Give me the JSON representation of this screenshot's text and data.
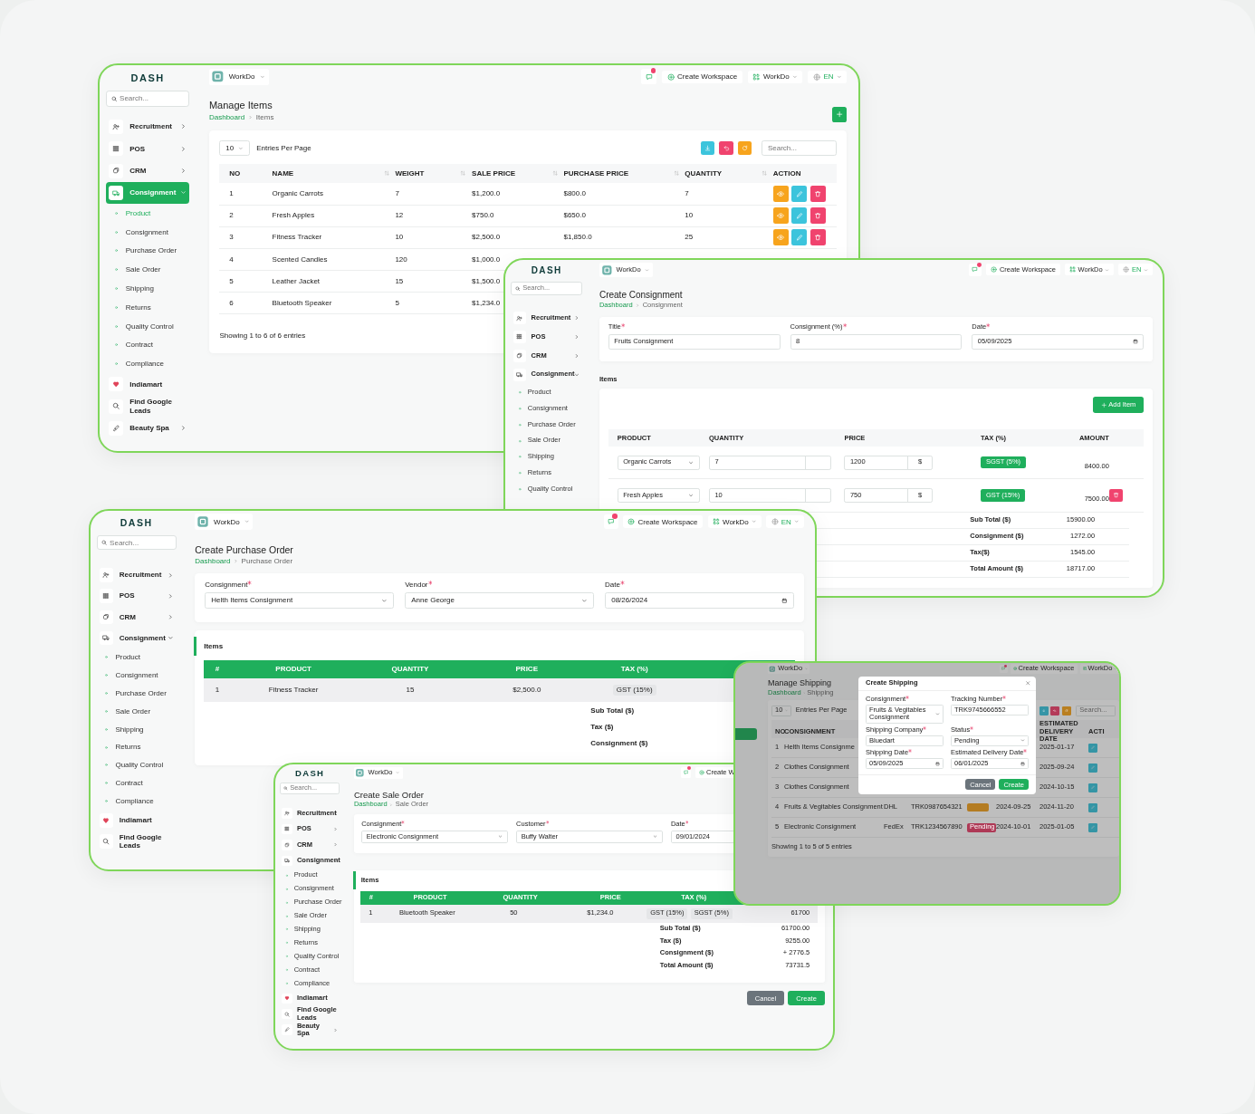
{
  "windows": [
    {
      "kind": "items_list",
      "logo": "DASH",
      "sidebar": {
        "search": "Search...",
        "items": [
          {
            "label": "Recruitment",
            "kind": "group",
            "selected": false,
            "expanded": false
          },
          {
            "label": "POS",
            "kind": "group",
            "selected": false,
            "expanded": false
          },
          {
            "label": "CRM",
            "kind": "group",
            "selected": false,
            "expanded": false
          },
          {
            "label": "Consignment",
            "kind": "group",
            "selected": true,
            "expanded": true,
            "children": [
              {
                "label": "Product",
                "selected": true
              },
              {
                "label": "Consignment",
                "selected": false
              },
              {
                "label": "Purchase Order",
                "selected": false
              },
              {
                "label": "Sale Order",
                "selected": false
              },
              {
                "label": "Shipping",
                "selected": false
              },
              {
                "label": "Returns",
                "selected": false
              },
              {
                "label": "Quality Control",
                "selected": false
              },
              {
                "label": "Contract",
                "selected": false
              },
              {
                "label": "Compliance",
                "selected": false
              }
            ]
          },
          {
            "label": "Indiamart",
            "kind": "link",
            "selected": false
          },
          {
            "label": "Find Google Leads",
            "kind": "link",
            "selected": false
          },
          {
            "label": "Beauty Spa",
            "kind": "group",
            "selected": false,
            "expanded": false
          }
        ]
      },
      "topbar": {
        "workspace": "WorkDo",
        "notification": true,
        "actions": [
          {
            "kind": "create",
            "label": "Create Workspace"
          },
          {
            "kind": "switch",
            "label": "WorkDo"
          },
          {
            "kind": "lang",
            "label": "EN"
          }
        ]
      },
      "title": "Manage Items",
      "breadcrumb": [
        "Dashboard",
        "Items"
      ],
      "add_button": true,
      "table": {
        "entries": "10",
        "entries_label": "Entries Per Page",
        "search": "Search...",
        "tools": [
          {
            "kind": "download",
            "color": "#3cc4dc"
          },
          {
            "kind": "undo",
            "color": "#f0436e"
          },
          {
            "kind": "refresh",
            "color": "#f7a41d"
          }
        ],
        "columns": [
          "NO",
          "NAME",
          "WEIGHT",
          "SALE PRICE",
          "PURCHASE PRICE",
          "QUANTITY",
          "ACTION"
        ],
        "rows": [
          {
            "cells": [
              "1",
              "Organic Carrots",
              "7",
              "$1,200.0",
              "$800.0",
              "7"
            ],
            "actions": true
          },
          {
            "cells": [
              "2",
              "Fresh Apples",
              "12",
              "$750.0",
              "$650.0",
              "10"
            ],
            "actions": true
          },
          {
            "cells": [
              "3",
              "Fitness Tracker",
              "10",
              "$2,500.0",
              "$1,850.0",
              "25"
            ],
            "actions": true
          },
          {
            "cells": [
              "4",
              "Scented Candles",
              "120",
              "$1,000.0"
            ]
          },
          {
            "cells": [
              "5",
              "Leather Jacket",
              "15",
              "$1,500.0"
            ]
          },
          {
            "cells": [
              "6",
              "Bluetooth Speaker",
              "5",
              "$1,234.0"
            ]
          }
        ],
        "footer": "Showing 1 to 6 of 6 entries"
      }
    },
    {
      "kind": "consignment_form",
      "logo": "DASH",
      "sidebar": {
        "search": "Search...",
        "items": [
          {
            "label": "Recruitment",
            "kind": "group",
            "selected": false,
            "expanded": false
          },
          {
            "label": "POS",
            "kind": "group",
            "selected": false,
            "expanded": false
          },
          {
            "label": "CRM",
            "kind": "group",
            "selected": false,
            "expanded": false
          },
          {
            "label": "Consignment",
            "kind": "group",
            "selected": false,
            "expanded": true,
            "children": [
              {
                "label": "Product",
                "selected": false
              },
              {
                "label": "Consignment",
                "selected": false
              },
              {
                "label": "Purchase Order",
                "selected": false
              },
              {
                "label": "Sale Order",
                "selected": false
              },
              {
                "label": "Shipping",
                "selected": false
              },
              {
                "label": "Returns",
                "selected": false
              },
              {
                "label": "Quality Control",
                "selected": false
              }
            ]
          }
        ]
      },
      "topbar": {
        "workspace": "WorkDo",
        "notification": true,
        "actions": [
          {
            "kind": "create",
            "label": "Create Workspace"
          },
          {
            "kind": "switch",
            "label": "WorkDo"
          },
          {
            "kind": "lang",
            "label": "EN"
          }
        ]
      },
      "title": "Create Consignment",
      "breadcrumb": [
        "Dashboard",
        "Consignment"
      ],
      "fields": [
        {
          "label": "Title",
          "required": true,
          "kind": "text",
          "value": "Fruits Consignment"
        },
        {
          "label": "Consignment (%)",
          "required": true,
          "kind": "text",
          "value": "8"
        },
        {
          "label": "Date",
          "required": true,
          "kind": "date",
          "value": "05/09/2025"
        }
      ],
      "items_title": "Items",
      "editor": {
        "add_label": "Add Item",
        "columns": [
          "PRODUCT",
          "QUANTITY",
          "PRICE",
          "TAX (%)",
          "AMOUNT"
        ],
        "rows": [
          {
            "product": "Organic Carrots",
            "quantity": "7",
            "price": "1200",
            "currency": "$",
            "taxes": [
              "SGST (5%)"
            ],
            "amount": "8400.00",
            "deletable": false
          },
          {
            "product": "Fresh Apples",
            "quantity": "10",
            "price": "750",
            "currency": "$",
            "taxes": [
              "GST (15%)"
            ],
            "amount": "7500.00",
            "deletable": true
          }
        ],
        "totals": [
          {
            "label": "Sub Total ($)",
            "value": "15900.00"
          },
          {
            "label": "Consignment ($)",
            "value": "1272.00"
          },
          {
            "label": "Tax($)",
            "value": "1545.00"
          },
          {
            "label": "Total Amount ($)",
            "value": "18717.00"
          }
        ]
      }
    },
    {
      "kind": "order_form",
      "logo": "DASH",
      "sidebar": {
        "search": "Search...",
        "items": [
          {
            "label": "Recruitment",
            "kind": "group",
            "selected": false,
            "expanded": false
          },
          {
            "label": "POS",
            "kind": "group",
            "selected": false,
            "expanded": false
          },
          {
            "label": "CRM",
            "kind": "group",
            "selected": false,
            "expanded": false
          },
          {
            "label": "Consignment",
            "kind": "group",
            "selected": false,
            "expanded": true,
            "children": [
              {
                "label": "Product",
                "selected": false
              },
              {
                "label": "Consignment",
                "selected": false
              },
              {
                "label": "Purchase Order",
                "selected": false
              },
              {
                "label": "Sale Order",
                "selected": false
              },
              {
                "label": "Shipping",
                "selected": false
              },
              {
                "label": "Returns",
                "selected": false
              },
              {
                "label": "Quality Control",
                "selected": false
              },
              {
                "label": "Contract",
                "selected": false
              },
              {
                "label": "Compliance",
                "selected": false
              }
            ]
          },
          {
            "label": "Indiamart",
            "kind": "link",
            "selected": false
          },
          {
            "label": "Find Google Leads",
            "kind": "link",
            "selected": false
          }
        ]
      },
      "topbar": {
        "workspace": "WorkDo",
        "notification": true,
        "actions": [
          {
            "kind": "create",
            "label": "Create Workspace"
          },
          {
            "kind": "switch",
            "label": "WorkDo"
          },
          {
            "kind": "lang",
            "label": "EN"
          }
        ]
      },
      "title": "Create Purchase Order",
      "breadcrumb": [
        "Dashboard",
        "Purchase Order"
      ],
      "fields": [
        {
          "label": "Consignment",
          "required": true,
          "kind": "select",
          "value": "Helth Items Consignment"
        },
        {
          "label": "Vendor",
          "required": true,
          "kind": "select",
          "value": "Anne George"
        },
        {
          "label": "Date",
          "required": true,
          "kind": "date",
          "value": "08/26/2024"
        }
      ],
      "order": {
        "title": "Items",
        "columns": [
          "#",
          "PRODUCT",
          "QUANTITY",
          "PRICE",
          "TAX (%)"
        ],
        "rows": [
          {
            "cells": [
              "1",
              "Fitness Tracker",
              "15",
              "$2,500.0"
            ],
            "taxes": [
              "GST (15%)"
            ]
          }
        ],
        "totals": [
          {
            "label": "Sub Total ($)"
          },
          {
            "label": "Tax ($)"
          },
          {
            "label": "Consignment ($)"
          }
        ]
      }
    },
    {
      "kind": "order_form",
      "logo": "DASH",
      "sidebar": {
        "search": "Search...",
        "items": [
          {
            "label": "Recruitment",
            "kind": "group",
            "selected": false,
            "expanded": false
          },
          {
            "label": "POS",
            "kind": "group",
            "selected": false,
            "expanded": false
          },
          {
            "label": "CRM",
            "kind": "group",
            "selected": false,
            "expanded": false
          },
          {
            "label": "Consignment",
            "kind": "group",
            "selected": false,
            "expanded": true,
            "children": [
              {
                "label": "Product",
                "selected": false
              },
              {
                "label": "Consignment",
                "selected": false
              },
              {
                "label": "Purchase Order",
                "selected": false
              },
              {
                "label": "Sale Order",
                "selected": false
              },
              {
                "label": "Shipping",
                "selected": false
              },
              {
                "label": "Returns",
                "selected": false
              },
              {
                "label": "Quality Control",
                "selected": false
              },
              {
                "label": "Contract",
                "selected": false
              },
              {
                "label": "Compliance",
                "selected": false
              }
            ]
          },
          {
            "label": "Indiamart",
            "kind": "link",
            "selected": false
          },
          {
            "label": "Find Google Leads",
            "kind": "link",
            "selected": false
          },
          {
            "label": "Beauty Spa",
            "kind": "group",
            "selected": false,
            "expanded": false
          }
        ]
      },
      "topbar": {
        "workspace": "WorkDo",
        "notification": true,
        "actions": [
          {
            "kind": "create",
            "label": "Create W"
          }
        ]
      },
      "title": "Create Sale Order",
      "breadcrumb": [
        "Dashboard",
        "Sale Order"
      ],
      "fields": [
        {
          "label": "Consignment",
          "required": true,
          "kind": "select",
          "value": "Electronic Consignment"
        },
        {
          "label": "Customer",
          "required": true,
          "kind": "select",
          "value": "Buffy Walter"
        },
        {
          "label": "Date",
          "required": true,
          "kind": "text",
          "value": "09/01/2024"
        }
      ],
      "order": {
        "title": "Items",
        "columns": [
          "#",
          "PRODUCT",
          "QUANTITY",
          "PRICE",
          "TAX (%)"
        ],
        "rows": [
          {
            "cells": [
              "1",
              "Bluetooth Speaker",
              "50",
              "$1,234.0"
            ],
            "taxes": [
              "GST (15%)",
              "SGST (5%)"
            ],
            "amount": "61700"
          }
        ],
        "totals": [
          {
            "label": "Sub Total ($)",
            "value": "61700.00"
          },
          {
            "label": "Tax ($)",
            "value": "9255.00"
          },
          {
            "label": "Consignment ($)",
            "value": "+ 2776.5"
          },
          {
            "label": "Total Amount ($)",
            "value": "73731.5"
          }
        ]
      },
      "buttons": [
        {
          "kind": "cancel",
          "label": "Cancel"
        },
        {
          "kind": "create",
          "label": "Create"
        }
      ]
    },
    {
      "kind": "shipping",
      "topbar": {
        "workspace": "WorkDo",
        "notification": true,
        "actions": [
          {
            "kind": "create",
            "label": "Create Workspace"
          },
          {
            "kind": "switch",
            "label": "WorkDo"
          }
        ]
      },
      "title": "Manage Shipping",
      "breadcrumb": [
        "Dashboard",
        "Shipping"
      ],
      "table": {
        "entries": "10",
        "entries_label": "Entries Per Page",
        "search": "Search...",
        "tools": [
          {
            "kind": "download",
            "color": "#3695a6"
          },
          {
            "kind": "undo",
            "color": "#b43b59"
          },
          {
            "kind": "refresh",
            "color": "#b97f20"
          }
        ],
        "columns": [
          {
            "label": "NO"
          },
          {
            "label": "CONSIGNMENT"
          },
          {},
          {},
          {},
          {},
          {
            "label": "ESTIMATED DELIVERY DATE"
          },
          {
            "label": "ACTI"
          }
        ],
        "rows": [
          {
            "no": "1",
            "consignment": "Helth Items Consignme",
            "delivery": "2025-01-17"
          },
          {
            "no": "2",
            "consignment": "Clothes Consignment",
            "delivery": "2025-09-24"
          },
          {
            "no": "3",
            "consignment": "Clothes Consignment",
            "delivery": "2024-10-15"
          },
          {
            "no": "4",
            "consignment": "Fruits & Vegitables Consignment",
            "company": "DHL",
            "tracking": "TRK0987654321",
            "status": {
              "color": "#b47c22"
            },
            "shipped": "2024-09-25",
            "delivery": "2024-11-20"
          },
          {
            "no": "5",
            "consignment": "Electronic Consignment",
            "company": "FedEx",
            "tracking": "TRK1234567890",
            "status": {
              "color": "#ae3956",
              "label": "Pending"
            },
            "shipped": "2024-10-01",
            "delivery": "2025-01-05"
          }
        ],
        "footer": "Showing 1 to 5 of 5 entries"
      },
      "modal": {
        "title": "Create Shipping",
        "fields": [
          {
            "label": "Consignment",
            "required": true,
            "kind": "select",
            "value": "Fruits & Vegitables Consignment"
          },
          {
            "label": "Tracking Number",
            "required": true,
            "kind": "text",
            "value": "TRK9745666552"
          },
          {
            "label": "Shipping Company",
            "required": true,
            "kind": "text",
            "value": "Bluedart"
          },
          {
            "label": "Status",
            "required": true,
            "kind": "select",
            "value": "Pending"
          },
          {
            "label": "Shipping Date",
            "required": true,
            "kind": "date",
            "value": "05/09/2025"
          },
          {
            "label": "Estimated Delivery Date",
            "required": true,
            "kind": "date",
            "value": "06/01/2025"
          }
        ],
        "buttons": [
          {
            "kind": "cancel",
            "label": "Cancel"
          },
          {
            "kind": "create",
            "label": "Create"
          }
        ]
      }
    }
  ]
}
